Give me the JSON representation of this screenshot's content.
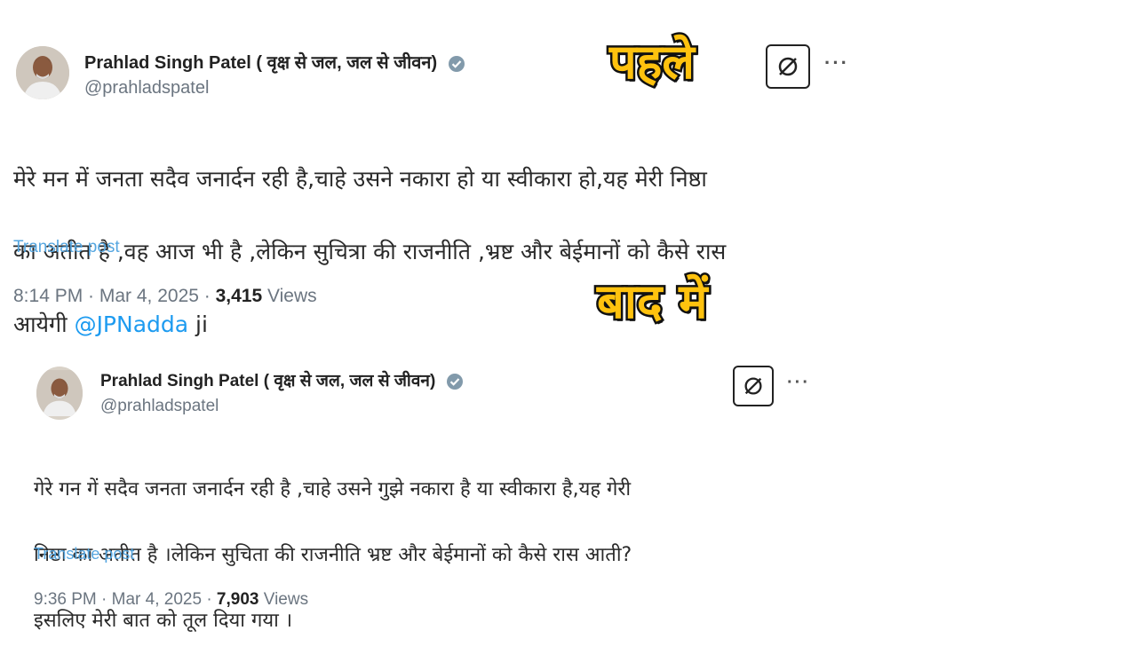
{
  "labels": {
    "before": "पहले",
    "after": "बाद में"
  },
  "before_post": {
    "name": "Prahlad Singh Patel ( वृक्ष से जल, जल से जीवन)",
    "handle": "@prahladspatel",
    "text_line1": "मेरे मन में जनता सदैव जनार्दन रही है,चाहे उसने नकारा हो या स्वीकारा हो,यह मेरी निष्ठा",
    "text_line2": "का अतीत है ,वह आज भी है ,लेकिन सुचित्रा की राजनीति ,भ्रष्ट और बेईमानों को कैसे रास",
    "text_line3_pre": "आयेगी ",
    "mention": "@JPNadda",
    "text_line3_post": " ji",
    "translate": "Translate post",
    "time": "8:14 PM · Mar 4, 2025 · ",
    "views_count": "3,415",
    "views_label": " Views",
    "more": "···"
  },
  "after_post": {
    "name": "Prahlad Singh Patel ( वृक्ष से जल, जल से जीवन)",
    "handle": "@prahladspatel",
    "text_line1": "गेरे गन गें सदैव जनता जनार्दन रही है ,चाहे उसने गुझे नकारा है या स्वीकारा है,यह गेरी",
    "text_line2": "निष्ठा का अतीत है ।लेकिन सुचिता की राजनीति भ्रष्ट और बेईमानों को कैसे रास आती?",
    "text_line3": "इसलिए मेरी बात को तूल दिया गया ।",
    "translate": "Translate post",
    "time": "9:36 PM · Mar 4, 2025 · ",
    "views_count": "7,903",
    "views_label": " Views",
    "more": "···"
  },
  "colors": {
    "mention": "#1d9bf0",
    "banner": "#ffc20e",
    "verified": "#829aab"
  }
}
